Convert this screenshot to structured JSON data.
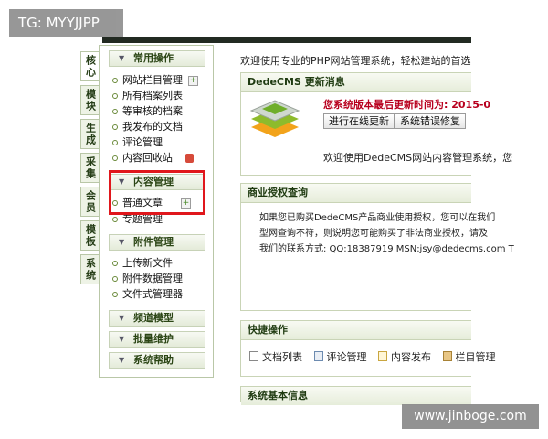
{
  "overlays": {
    "tag": "TG: MYYJJPP",
    "watermark": "www.jinboge.com"
  },
  "vertical_tabs": [
    "核心",
    "模块",
    "生成",
    "采集",
    "会员",
    "模板",
    "系统"
  ],
  "sidebar": {
    "sections": [
      {
        "label": "常用操作",
        "items": [
          {
            "label": "网站栏目管理",
            "icon": "add-icon"
          },
          {
            "label": "所有档案列表"
          },
          {
            "label": "等审核的档案"
          },
          {
            "label": "我发布的文档"
          },
          {
            "label": "评论管理"
          },
          {
            "label": "内容回收站",
            "icon": "trash-icon"
          }
        ]
      },
      {
        "label": "内容管理",
        "items": [
          {
            "label": "普通文章",
            "icon": "add-icon"
          },
          {
            "label": "专题管理"
          }
        ]
      },
      {
        "label": "附件管理",
        "items": [
          {
            "label": "上传新文件"
          },
          {
            "label": "附件数据管理"
          },
          {
            "label": "文件式管理器"
          }
        ]
      },
      {
        "label": "频道模型",
        "items": []
      },
      {
        "label": "批量维护",
        "items": []
      },
      {
        "label": "系统帮助",
        "items": []
      }
    ]
  },
  "main": {
    "welcome": "欢迎使用专业的PHP网站管理系统，轻松建站的首选利器 --",
    "update_panel": {
      "title": "DedeCMS 更新消息",
      "last_update": "您系统版本最后更新时间为: 2015-0",
      "btn_online": "进行在线更新",
      "btn_repair": "系统错误修复",
      "welcome_text": "欢迎使用DedeCMS网站内容管理系统，您"
    },
    "license_panel": {
      "title": "商业授权查询",
      "lines": [
        "如果您已购买DedeCMS产品商业使用授权，您可以在我们",
        "型网查询不符，则说明您可能购买了非法商业授权，请及",
        "我们的联系方式: QQ:18387919 MSN:jsy@dedecms.com T"
      ]
    },
    "quick_panel": {
      "title": "快捷操作",
      "items": [
        {
          "label": "文档列表",
          "icon": "document-icon"
        },
        {
          "label": "评论管理",
          "icon": "comment-icon"
        },
        {
          "label": "内容发布",
          "icon": "edit-icon"
        },
        {
          "label": "栏目管理",
          "icon": "folder-icon"
        }
      ]
    },
    "sysinfo_panel": {
      "title": "系统基本信息"
    }
  },
  "colors": {
    "accent_green": "#2b4515",
    "highlight_red": "#e0171c",
    "update_red": "#b8001e"
  }
}
